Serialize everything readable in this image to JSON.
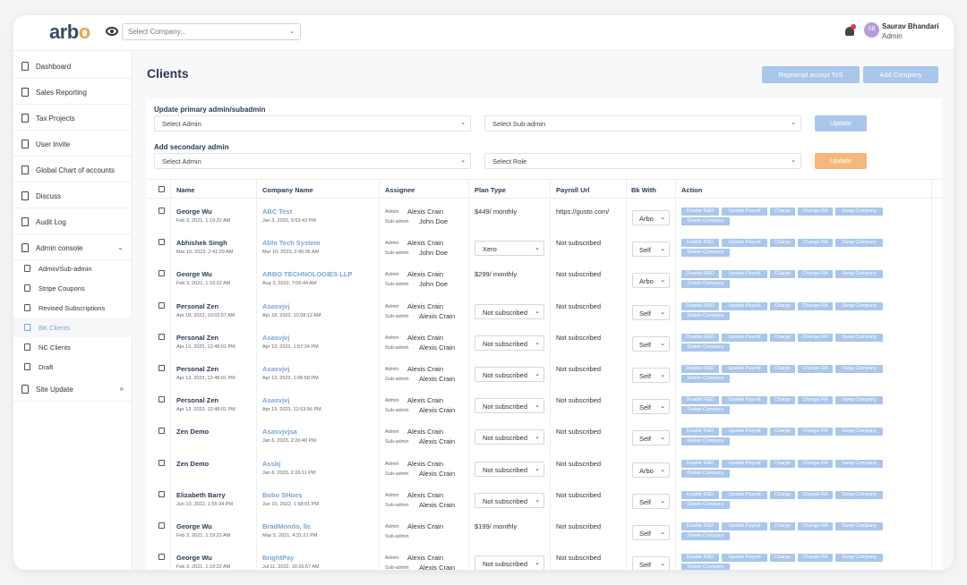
{
  "header": {
    "logo_main": "arb",
    "logo_accent": "o",
    "company_placeholder": "Select Company...",
    "user_initials": "SB",
    "user_name": "Saurav Bhandari",
    "user_role": "Admin"
  },
  "sidebar": {
    "items": [
      {
        "label": "Dashboard",
        "icon": "home-icon"
      },
      {
        "label": "Sales Reporting",
        "icon": "document-icon"
      },
      {
        "label": "Tax Projects",
        "icon": "document-icon"
      },
      {
        "label": "User Invite",
        "icon": "document-icon"
      },
      {
        "label": "Global Chart of accounts",
        "icon": "document-icon"
      },
      {
        "label": "Discuss",
        "icon": "document-icon"
      },
      {
        "label": "Audit Log",
        "icon": "document-icon"
      },
      {
        "label": "Admin console",
        "icon": "home-icon",
        "arrow": "⌄"
      }
    ],
    "sub_items": [
      {
        "label": "Admin/Sub-admin"
      },
      {
        "label": "Stripe Coupons"
      },
      {
        "label": "Revised Subscriptions"
      },
      {
        "label": "BK Clients"
      },
      {
        "label": "NC Clients"
      },
      {
        "label": "Draft"
      }
    ],
    "site_update": {
      "label": "Site Update",
      "arrow": "»"
    }
  },
  "main": {
    "title": "Clients",
    "reprompt_button": "Reprompt accept ToS",
    "add_company_button": "Add Company",
    "primary_label": "Update primary admin/subadmin",
    "primary_admin_select": "Select Admin",
    "primary_subadmin_select": "Select Sub-admin",
    "primary_update": "Update",
    "secondary_label": "Add secondary admin",
    "secondary_admin_select": "Select Admin",
    "secondary_role_select": "Select Role",
    "secondary_update": "Update",
    "accent_blue": "#a9c6ec",
    "accent_orange": "#f8b77a"
  },
  "table": {
    "headers": [
      "Name",
      "Company Name",
      "Assignee",
      "Plan Type",
      "Payroll Url",
      "Bk With",
      "Action"
    ],
    "admin_prefix": "Admin",
    "subadmin_prefix": "Sub-admin",
    "rows": [
      {
        "name": "George Wu",
        "name_date": "Feb 3, 2021, 1:19:22 AM",
        "company": "ABC Test",
        "company_date": "Jan 3, 2023, 9:53:43 PM",
        "admin": "Alexis Crain",
        "subadmin": "John Doe",
        "plan": "$449/ monthly",
        "plan_is_select": false,
        "payroll": "https://gusto.com/",
        "bk": "Arbo",
        "first_action": "Enable R&D"
      },
      {
        "name": "Abhishek Singh",
        "name_date": "Mar 10, 2023, 2:41:29 AM",
        "company": "Abhi Tech System",
        "company_date": "Mar 10, 2023, 2:45:06 AM",
        "admin": "Alexis Crain",
        "subadmin": "John Doe",
        "plan": "Xero",
        "plan_is_select": true,
        "payroll": "Not subscribed",
        "bk": "Self",
        "first_action": "Enable R&D"
      },
      {
        "name": "George Wu",
        "name_date": "Feb 3, 2021, 1:19:22 AM",
        "company": "ARBO TECHNOLOGIES LLP",
        "company_date": "Aug 3, 2022, 7:06:44 AM",
        "admin": "Alexis Crain",
        "subadmin": "John Doe",
        "plan": "$299/ monthly",
        "plan_is_select": false,
        "payroll": "Not subscribed",
        "bk": "Arbo",
        "first_action": "Disable R&D"
      },
      {
        "name": "Personal Zen",
        "name_date": "Apr 18, 2023, 10:02:57 AM",
        "company": "Asasvjvj",
        "company_date": "Apr 18, 2023, 10:08:12 AM",
        "admin": "Alexis Crain",
        "subadmin": "Alexis Crain",
        "plan": "Not subscribed",
        "plan_is_select": true,
        "payroll": "Not subscribed",
        "bk": "Self",
        "first_action": "Disable R&D"
      },
      {
        "name": "Personal Zen",
        "name_date": "Apr 13, 2023, 12:48:01 PM",
        "company": "Asasvjvj",
        "company_date": "Apr 13, 2023, 1:57:34 PM",
        "admin": "Alexis Crain",
        "subadmin": "Alexis Crain",
        "plan": "Not subscribed",
        "plan_is_select": true,
        "payroll": "Not subscribed",
        "bk": "Self",
        "first_action": "Disable R&D"
      },
      {
        "name": "Personal Zen",
        "name_date": "Apr 13, 2023, 12:48:01 PM",
        "company": "Asasvjvj",
        "company_date": "Apr 13, 2023, 1:08:58 PM",
        "admin": "Alexis Crain",
        "subadmin": "Alexis Crain",
        "plan": "Not subscribed",
        "plan_is_select": true,
        "payroll": "Not subscribed",
        "bk": "Self",
        "first_action": "Disable R&D"
      },
      {
        "name": "Personal Zen",
        "name_date": "Apr 13, 2023, 12:48:01 PM",
        "company": "Asasvjvj",
        "company_date": "Apr 13, 2023, 12:53:56 PM",
        "admin": "Alexis Crain",
        "subadmin": "Alexis Crain",
        "plan": "Not subscribed",
        "plan_is_select": true,
        "payroll": "Not subscribed",
        "bk": "Self",
        "first_action": "Disable R&D"
      },
      {
        "name": "Zen Demo",
        "name_date": "",
        "company": "Asasvjvjsa",
        "company_date": "Jan 6, 2023, 2:26:40 PM",
        "admin": "Alexis Crain",
        "subadmin": "Alexis Crain",
        "plan": "Not subscribed",
        "plan_is_select": true,
        "payroll": "Not subscribed",
        "bk": "Self",
        "first_action": "Enable R&D"
      },
      {
        "name": "Zen Demo",
        "name_date": "",
        "company": "Assbj",
        "company_date": "Jan 6, 2023, 2:26:11 PM",
        "admin": "Alexis Crain",
        "subadmin": "Alexis Crain",
        "plan": "Not subscribed",
        "plan_is_select": true,
        "payroll": "Not subscribed",
        "bk": "Arbo",
        "first_action": "Enable R&D"
      },
      {
        "name": "Elizabeth Barry",
        "name_date": "Jun 10, 2022, 1:55:34 PM",
        "company": "Bobo SHoes",
        "company_date": "Jun 10, 2022, 1:58:01 PM",
        "admin": "Alexis Crain",
        "subadmin": "Alexis Crain",
        "plan": "Not subscribed",
        "plan_is_select": true,
        "payroll": "Not subscribed",
        "bk": "Self",
        "first_action": "Enable R&D"
      },
      {
        "name": "George Wu",
        "name_date": "Feb 3, 2021, 1:19:22 AM",
        "company": "BradMondo, llc",
        "company_date": "May 5, 2021, 4:31:21 PM",
        "admin": "Alexis Crain",
        "subadmin": "",
        "plan": "$199/ monthly",
        "plan_is_select": false,
        "payroll": "Not subscribed",
        "bk": "Self",
        "first_action": "Enable R&D"
      },
      {
        "name": "George Wu",
        "name_date": "Feb 3, 2021, 1:19:22 AM",
        "company": "BrightPay",
        "company_date": "Jul 11, 2022, 10:26:57 AM",
        "admin": "Alexis Crain",
        "subadmin": "Alexis Crain",
        "plan": "Not subscribed",
        "plan_is_select": true,
        "payroll": "Not subscribed",
        "bk": "Self",
        "first_action": "Enable R&D"
      }
    ],
    "actions": [
      "Update Payroll",
      "Charge",
      "Change RA",
      "Swap Company",
      "Delete Company"
    ]
  }
}
